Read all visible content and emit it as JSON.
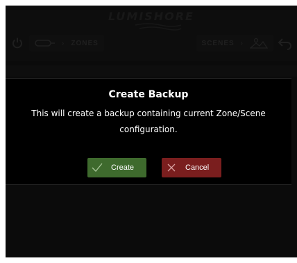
{
  "app": {
    "logo_text": "LUMISHORE"
  },
  "nav": {
    "zones_label": "ZONES",
    "scenes_label": "SCENES"
  },
  "dialog": {
    "title": "Create Backup",
    "message": "This will create a backup containing current Zone/Scene configuration.",
    "create_label": "Create",
    "cancel_label": "Cancel"
  },
  "colors": {
    "create_button": "#3e6a2d",
    "cancel_button": "#7a1e1e",
    "dialog_background": "#000000"
  },
  "icons": [
    "power-icon",
    "zones-icon",
    "scenes-icon",
    "back-arrow-icon",
    "checkmark-icon",
    "close-x-icon"
  ]
}
